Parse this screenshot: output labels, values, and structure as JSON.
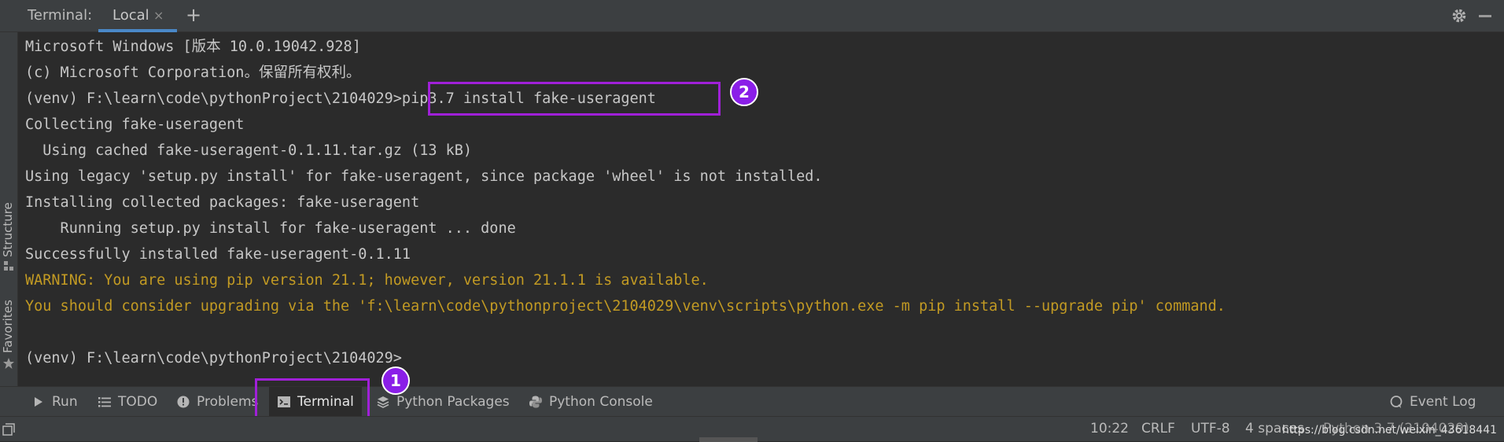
{
  "topbar": {
    "title": "Terminal:",
    "tab_label": "Local",
    "tab_close": "×",
    "add_label": "+"
  },
  "leftstrip": {
    "structure_label": "Structure",
    "favorites_label": "Favorites"
  },
  "terminal": {
    "lines": [
      {
        "text": "Microsoft Windows [版本 10.0.19042.928]",
        "kind": "normal"
      },
      {
        "text": "(c) Microsoft Corporation。保留所有权利。",
        "kind": "normal"
      },
      {
        "text": "(venv) F:\\learn\\code\\pythonProject\\2104029>pip3.7 install fake-useragent",
        "kind": "normal"
      },
      {
        "text": "Collecting fake-useragent",
        "kind": "normal"
      },
      {
        "text": "  Using cached fake-useragent-0.1.11.tar.gz (13 kB)",
        "kind": "normal"
      },
      {
        "text": "Using legacy 'setup.py install' for fake-useragent, since package 'wheel' is not installed.",
        "kind": "normal"
      },
      {
        "text": "Installing collected packages: fake-useragent",
        "kind": "normal"
      },
      {
        "text": "    Running setup.py install for fake-useragent ... done",
        "kind": "normal"
      },
      {
        "text": "Successfully installed fake-useragent-0.1.11",
        "kind": "normal"
      },
      {
        "text": "WARNING: You are using pip version 21.1; however, version 21.1.1 is available.",
        "kind": "warn"
      },
      {
        "text": "You should consider upgrading via the 'f:\\learn\\code\\pythonproject\\2104029\\venv\\scripts\\python.exe -m pip install --upgrade pip' command.",
        "kind": "warn"
      },
      {
        "text": "",
        "kind": "normal"
      },
      {
        "text": "(venv) F:\\learn\\code\\pythonProject\\2104029>",
        "kind": "normal"
      }
    ],
    "badge_2": "2"
  },
  "toolbar": {
    "run": "Run",
    "todo": "TODO",
    "problems": "Problems",
    "terminal": "Terminal",
    "python_packages": "Python Packages",
    "python_console": "Python Console",
    "event_log": "Event Log",
    "badge_1": "1"
  },
  "statusbar": {
    "position": "10:22",
    "line_sep": "CRLF",
    "encoding": "UTF-8",
    "indent": "4 spaces",
    "interpreter": "Python 3.7 (2104029)",
    "watermark": "https://blog.csdn.net/weixin_43618441"
  },
  "colors": {
    "background": "#2b2b2b",
    "panel": "#3c3f41",
    "warning_text": "#c29a23",
    "annotation": "#a020d8",
    "tab_underline": "#4a88c7"
  }
}
